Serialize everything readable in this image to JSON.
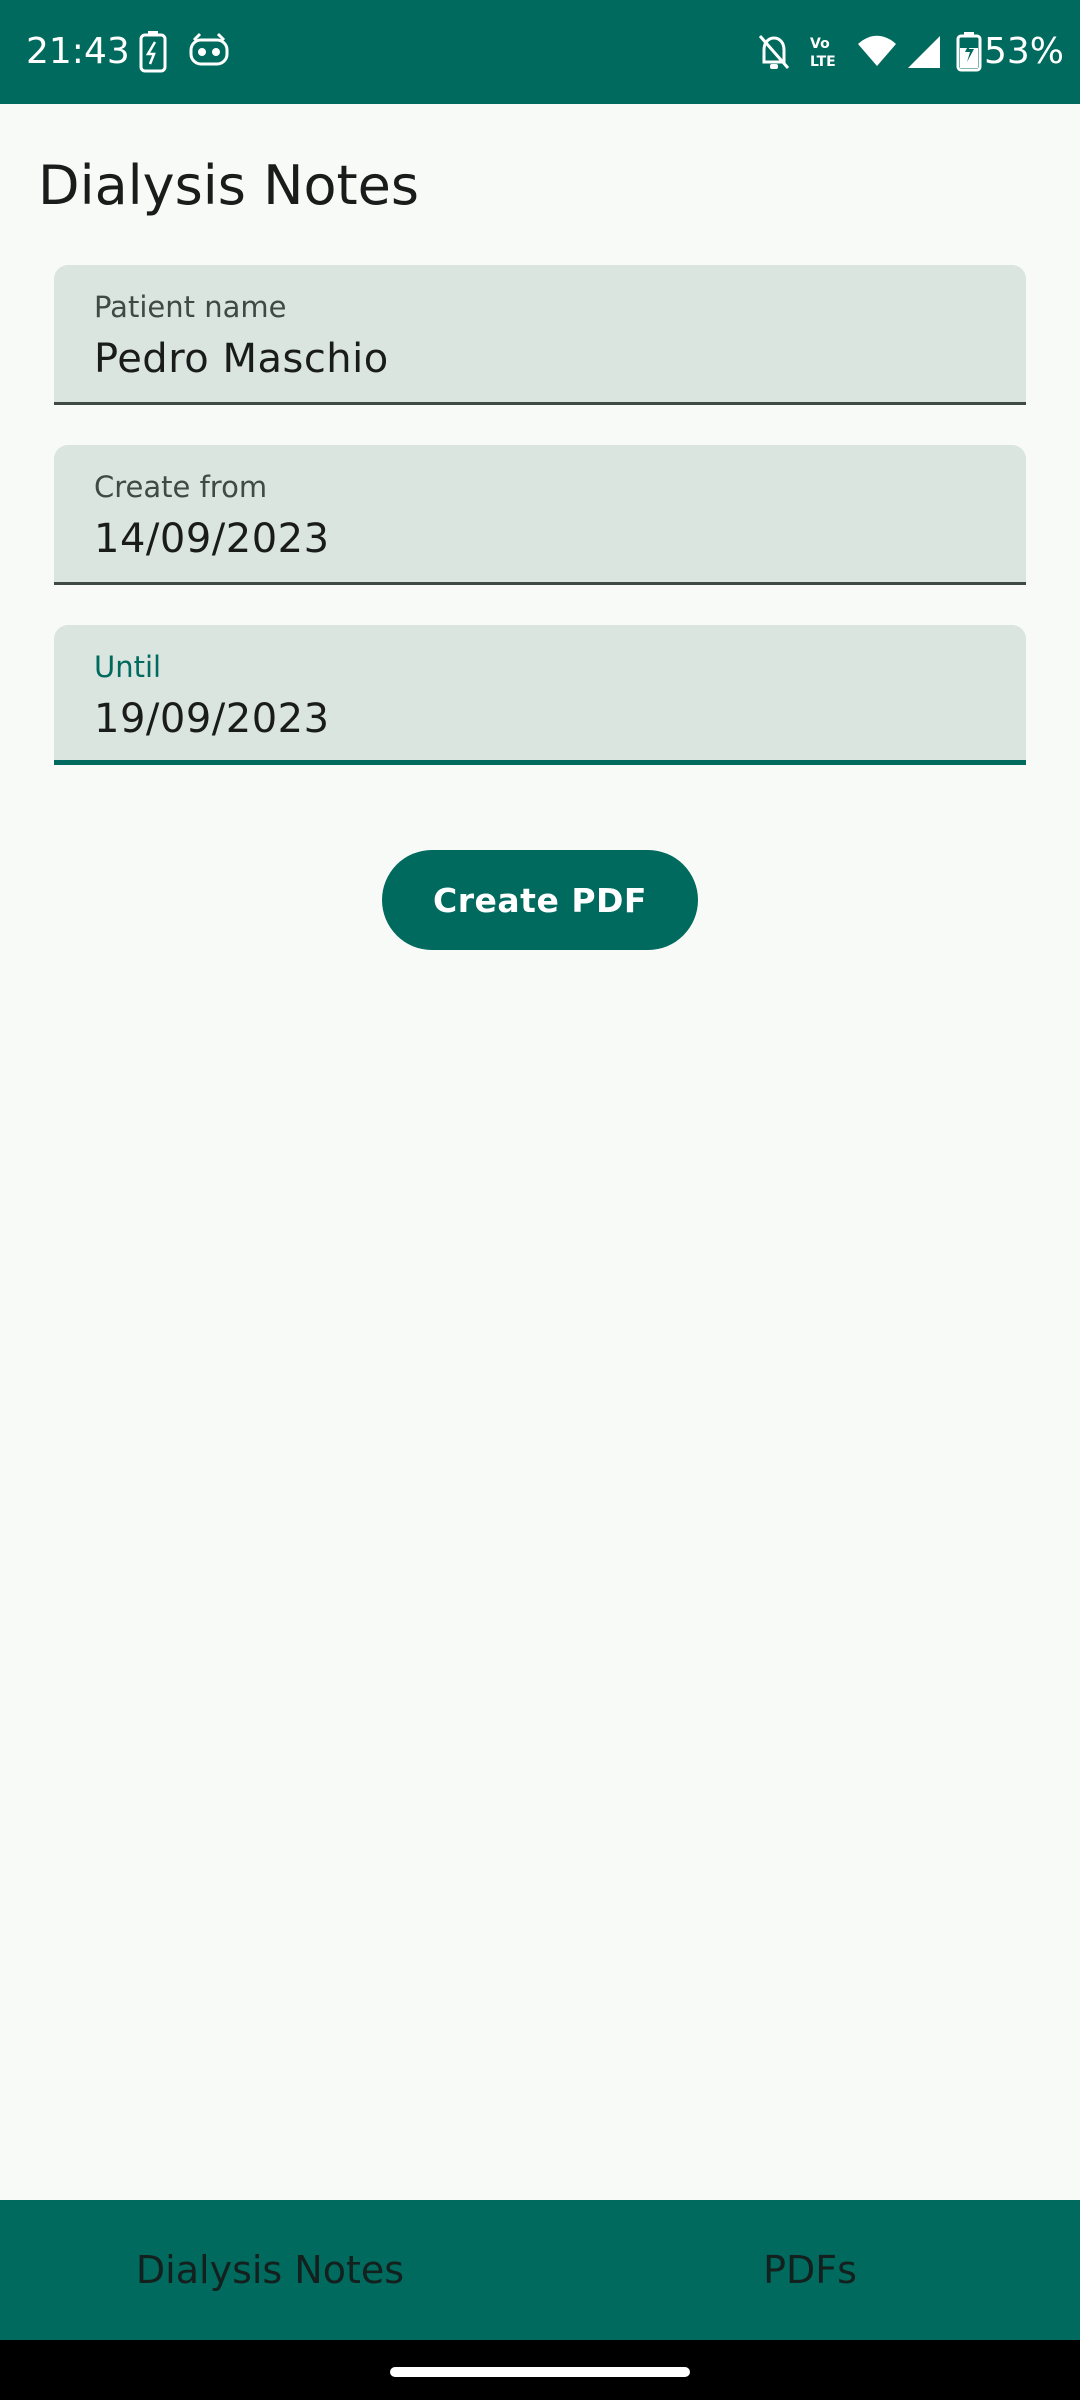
{
  "status_bar": {
    "time": "21:43",
    "battery_percent": "53%",
    "icons": [
      "battery-saver-icon",
      "app-notification-icon",
      "bell-off-icon",
      "volte-icon",
      "wifi-icon",
      "signal-icon",
      "battery-charging-icon"
    ]
  },
  "page": {
    "title": "Dialysis Notes"
  },
  "form": {
    "patient_name": {
      "label": "Patient name",
      "value": "Pedro Maschio"
    },
    "create_from": {
      "label": "Create from",
      "value": "14/09/2023"
    },
    "until": {
      "label": "Until",
      "value": "19/09/2023",
      "focused": true
    }
  },
  "actions": {
    "create_pdf_label": "Create PDF"
  },
  "bottom_nav": {
    "items": [
      {
        "label": "Dialysis Notes"
      },
      {
        "label": "PDFs"
      }
    ]
  },
  "colors": {
    "primary": "#006a5e",
    "field_bg": "#dae5e0",
    "background": "#f8faf8"
  }
}
